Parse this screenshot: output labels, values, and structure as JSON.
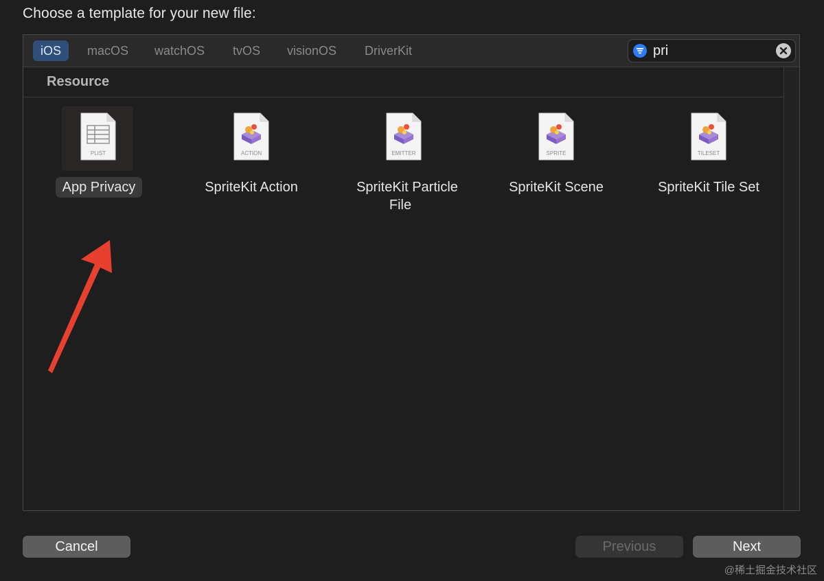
{
  "dialog": {
    "title": "Choose a template for your new file:"
  },
  "tabs": [
    {
      "label": "iOS",
      "active": true
    },
    {
      "label": "macOS",
      "active": false
    },
    {
      "label": "watchOS",
      "active": false
    },
    {
      "label": "tvOS",
      "active": false
    },
    {
      "label": "visionOS",
      "active": false
    },
    {
      "label": "DriverKit",
      "active": false
    }
  ],
  "search": {
    "value": "pri",
    "filter_icon": "filter-icon",
    "clear_icon": "clear-icon"
  },
  "section": {
    "title": "Resource"
  },
  "templates": [
    {
      "name": "App Privacy",
      "badge": "PLIST",
      "icon": "plist-file-icon",
      "selected": true
    },
    {
      "name": "SpriteKit Action",
      "badge": "ACTION",
      "icon": "spritekit-file-icon",
      "selected": false
    },
    {
      "name": "SpriteKit Particle File",
      "badge": "EMITTER",
      "icon": "spritekit-file-icon",
      "selected": false
    },
    {
      "name": "SpriteKit Scene",
      "badge": "SPRITE",
      "icon": "spritekit-file-icon",
      "selected": false
    },
    {
      "name": "SpriteKit Tile Set",
      "badge": "TILESET",
      "icon": "spritekit-file-icon",
      "selected": false
    }
  ],
  "buttons": {
    "cancel": "Cancel",
    "previous": "Previous",
    "next": "Next",
    "previous_enabled": false
  },
  "annotation": {
    "color": "#e8402f"
  },
  "watermark": "@稀土掘金技术社区",
  "colors": {
    "accent": "#2f7cf6",
    "active_tab": "#2f4e7a"
  }
}
